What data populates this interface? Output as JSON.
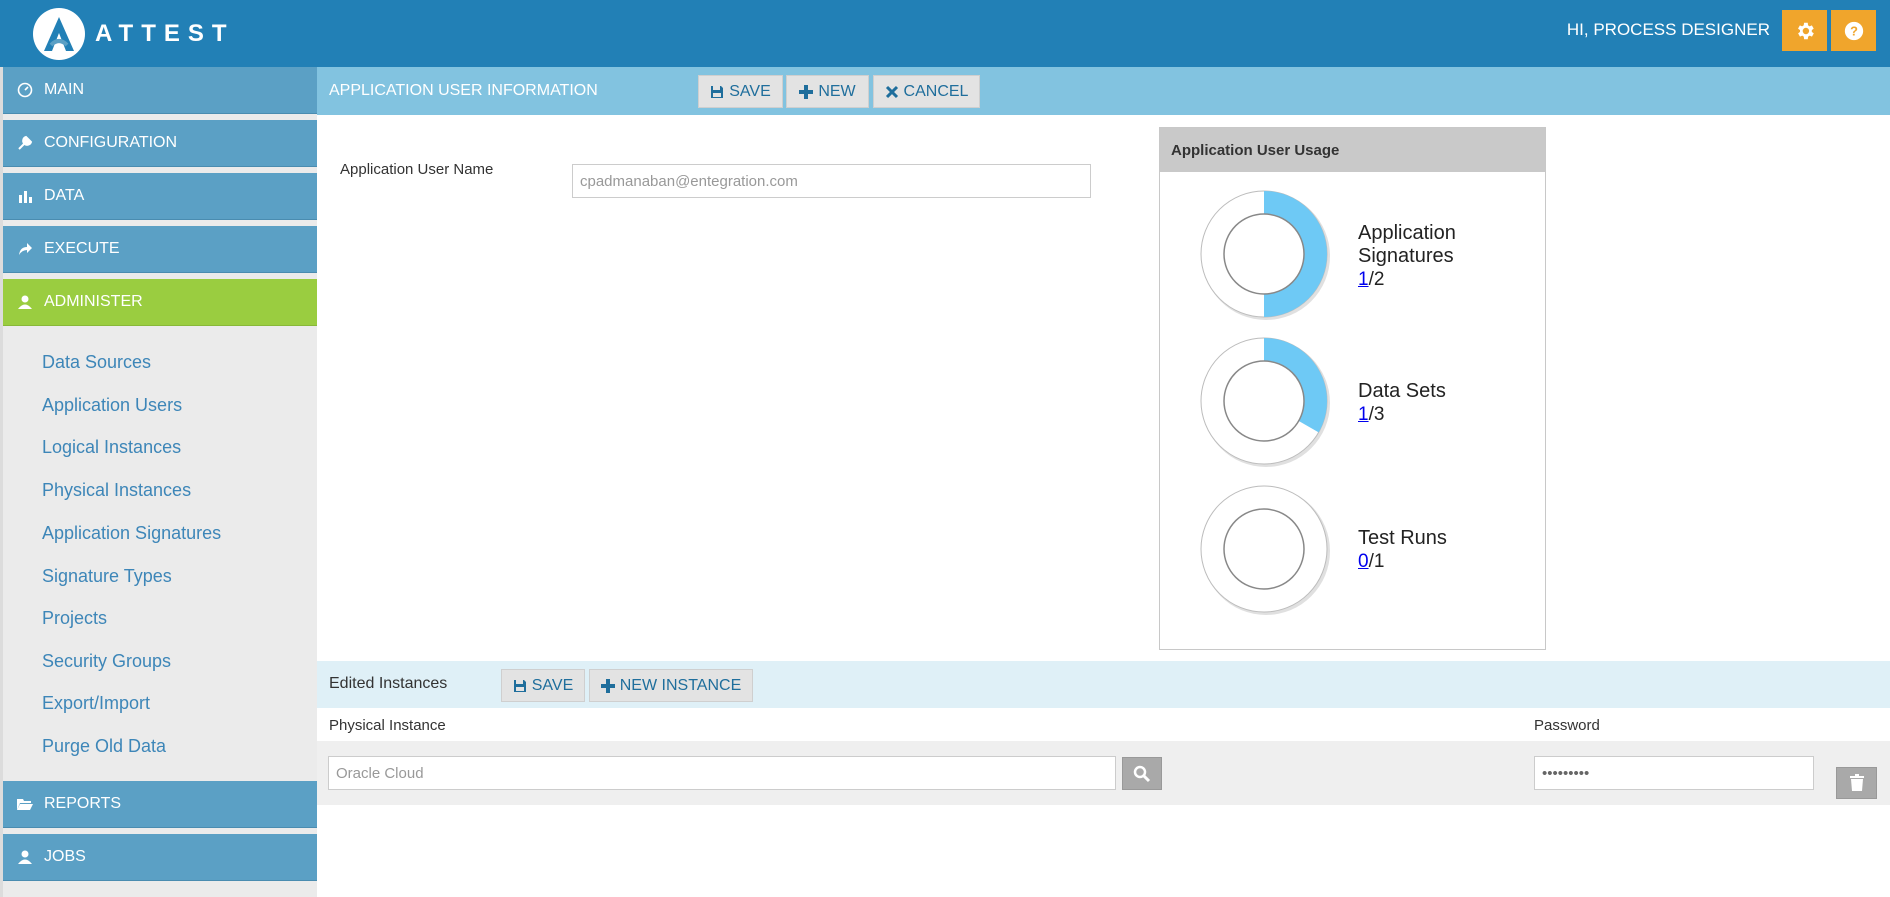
{
  "header": {
    "logo_text": "ATTEST",
    "greeting": "HI, PROCESS DESIGNER",
    "settings_icon": "gear-icon",
    "help_icon": "question-icon",
    "colors": {
      "bar": "#2280b6",
      "accent": "#f0a52c"
    }
  },
  "sidebar": {
    "nav": [
      {
        "label": "MAIN",
        "icon": "dashboard-icon"
      },
      {
        "label": "CONFIGURATION",
        "icon": "wrench-icon"
      },
      {
        "label": "DATA",
        "icon": "bar-chart-icon"
      },
      {
        "label": "EXECUTE",
        "icon": "share-arrow-icon"
      },
      {
        "label": "ADMINISTER",
        "icon": "user-icon",
        "active": true
      },
      {
        "label": "REPORTS",
        "icon": "folder-open-icon"
      },
      {
        "label": "JOBS",
        "icon": "user-icon"
      }
    ],
    "sub_items": [
      "Data Sources",
      "Application Users",
      "Logical Instances",
      "Physical Instances",
      "Application Signatures",
      "Signature Types",
      "Projects",
      "Security Groups",
      "Export/Import",
      "Purge Old Data"
    ]
  },
  "main": {
    "section_title": "APPLICATION USER INFORMATION",
    "toolbar": {
      "save": "SAVE",
      "new": "NEW",
      "cancel": "CANCEL"
    },
    "user_name_label": "Application User Name",
    "user_name_value": "cpadmanaban@entegration.com"
  },
  "usage": {
    "title": "Application User Usage",
    "items": [
      {
        "label_line1": "Application",
        "label_line2": "Signatures",
        "used": "1",
        "total": "/2",
        "fraction": 0.5
      },
      {
        "label_line1": "Data Sets",
        "label_line2": "",
        "used": "1",
        "total": "/3",
        "fraction": 0.333
      },
      {
        "label_line1": "Test Runs",
        "label_line2": "",
        "used": "0",
        "total": "/1",
        "fraction": 0
      }
    ],
    "fill_color": "#6ec9f5"
  },
  "edited": {
    "title": "Edited Instances",
    "save": "SAVE",
    "new_instance": "NEW INSTANCE",
    "col_physical": "Physical Instance",
    "col_password": "Password",
    "physical_placeholder": "Oracle Cloud",
    "password_value": "•••••••••"
  }
}
